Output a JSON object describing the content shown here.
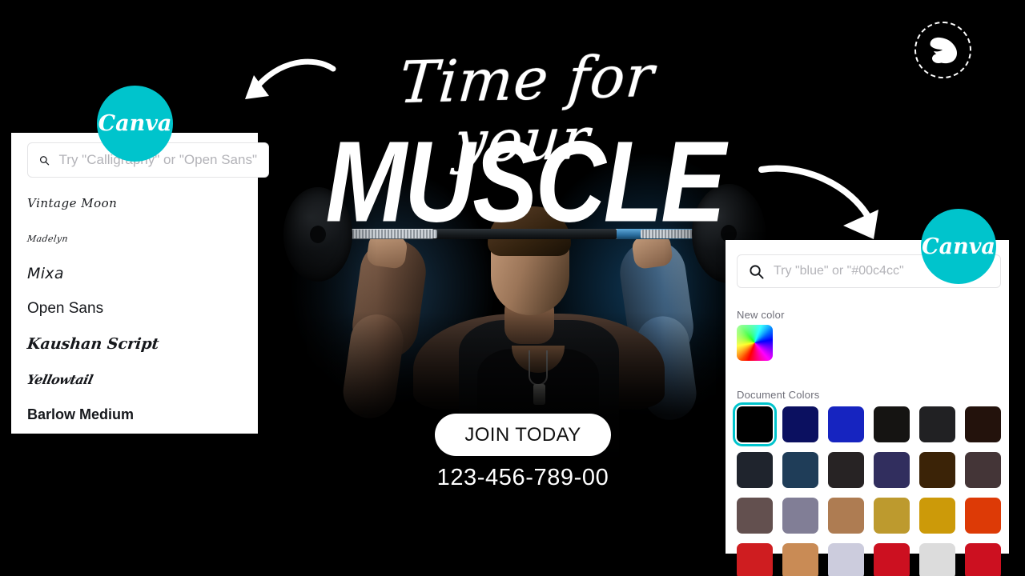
{
  "poster": {
    "script_headline": "Time for your",
    "main_headline": "MUSCLE",
    "cta_label": "JOIN TODAY",
    "phone": "123-456-789-00",
    "logo_icon": "flexed-bicep-icon",
    "arrow_left_icon": "curved-arrow-left-icon",
    "arrow_right_icon": "curved-arrow-right-icon",
    "background": "#000000",
    "text_color": "#ffffff"
  },
  "brand": {
    "badge_label": "Canva",
    "badge_color": "#00c4cc"
  },
  "font_panel": {
    "search": {
      "icon": "search-icon",
      "placeholder": "Try \"Calligraphy\" or \"Open Sans\"",
      "value": ""
    },
    "fonts": [
      {
        "name": "Vintage Moon",
        "style": "f-vintage"
      },
      {
        "name": "Madelyn",
        "style": "f-madelyn"
      },
      {
        "name": "Mixa",
        "style": "f-mixa"
      },
      {
        "name": "Open Sans",
        "style": "f-opensans"
      },
      {
        "name": "Kaushan Script",
        "style": "f-kaushan"
      },
      {
        "name": "Yellowtail",
        "style": "f-yellowtail"
      },
      {
        "name": "Barlow Medium",
        "style": "f-barlow"
      }
    ]
  },
  "color_panel": {
    "search": {
      "icon": "search-icon",
      "placeholder": "Try \"blue\" or \"#00c4cc\"",
      "value": ""
    },
    "new_color_label": "New color",
    "picker_icon": "color-wheel-icon",
    "document_colors_label": "Document Colors",
    "selected_index": 0,
    "selection_ring_color": "#00c4cc",
    "swatches": [
      "#000000",
      "#0b1060",
      "#1624c0",
      "#151412",
      "#212123",
      "#23120c",
      "#1f242d",
      "#1f3d58",
      "#272324",
      "#312e5e",
      "#3b2307",
      "#443537",
      "#63504f",
      "#817e96",
      "#ae7c52",
      "#bd9a2e",
      "#cc9a09",
      "#dd3a06",
      "#cf1d20",
      "#c98b55",
      "#ccccdd",
      "#cc1020",
      "#dcdcdc",
      "#cc1020"
    ]
  }
}
